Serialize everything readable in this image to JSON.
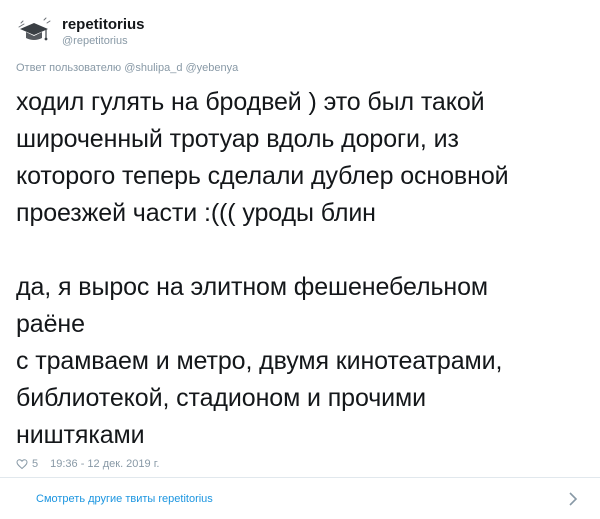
{
  "tweet": {
    "display_name": "repetitorius",
    "handle": "@repetitorius",
    "reply_prefix": "Ответ пользователю",
    "reply_mentions": "@shulipa_d @yebenya",
    "text": "ходил гулять на бродвей ) это был такой\nшироченный тротуар вдоль дороги, из\nкоторого теперь сделали дублер основной\nпроезжей части :((( уроды блин\n\nда, я вырос на элитном фешенебельном\nраёне\nс трамваем и метро, двумя кинотеатрами,\nбиблиотекой, стадионом и прочими\nништяками",
    "likes": "5",
    "timestamp": "19:36 - 12 дек. 2019 г."
  },
  "footer": {
    "more_tweets_label": "Смотреть другие твиты repetitorius"
  },
  "icons": {
    "avatar": "graduation-cap-avatar",
    "like": "heart-icon",
    "more": "chevron-right-icon"
  },
  "colors": {
    "text": "#14171a",
    "secondary": "#8899a6",
    "link": "#1b95e0",
    "divider": "#e1e8ed"
  }
}
